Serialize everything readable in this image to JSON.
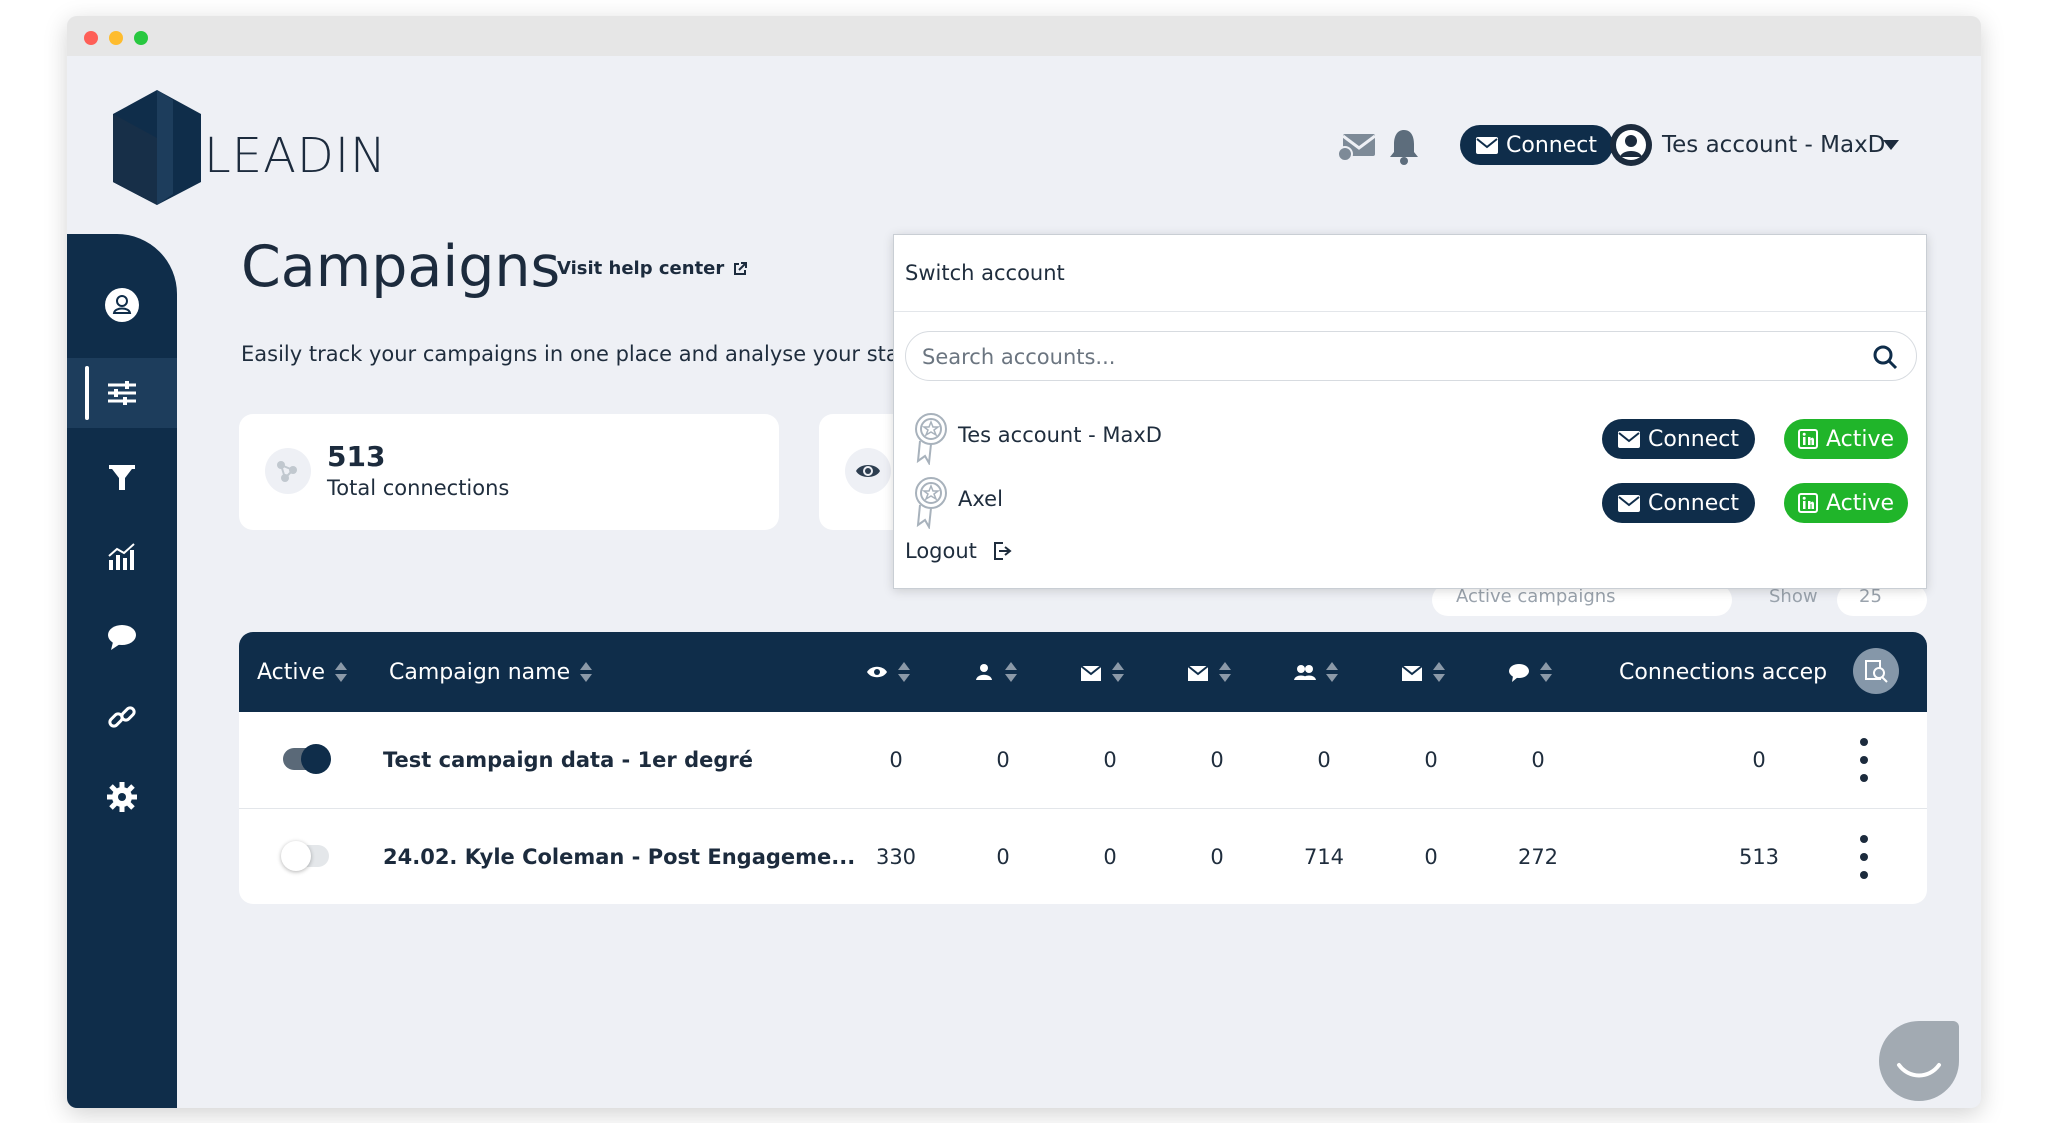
{
  "brand": {
    "name": "LEADIN"
  },
  "header": {
    "connect_label": "Connect",
    "account_name": "Tes account - MaxD"
  },
  "sidebar": {
    "items": [
      "profile",
      "campaigns",
      "filter",
      "stats",
      "messages",
      "links",
      "settings"
    ]
  },
  "page": {
    "title": "Campaigns",
    "help_link": "Visit help center",
    "subtitle": "Easily track your campaigns in one place and analyse your sta"
  },
  "stats": {
    "total_connections_value": "513",
    "total_connections_label": "Total connections"
  },
  "behind_dropdown": {
    "filter_label": "Active campaigns",
    "show_label": "Show",
    "show_value": "25"
  },
  "table": {
    "headers": {
      "active": "Active",
      "campaign_name": "Campaign name",
      "connections": "Connections accep"
    },
    "rows": [
      {
        "active": true,
        "name": "Test campaign data - 1er degré",
        "values": [
          "0",
          "0",
          "0",
          "0",
          "0",
          "0",
          "0"
        ],
        "connections": "0"
      },
      {
        "active": false,
        "name": "24.02. Kyle Coleman - Post Engageme...",
        "values": [
          "330",
          "0",
          "0",
          "0",
          "714",
          "0",
          "272"
        ],
        "connections": "513"
      }
    ]
  },
  "dropdown": {
    "title": "Switch account",
    "search_placeholder": "Search accounts...",
    "accounts": [
      {
        "name": "Tes account - MaxD",
        "connect_label": "Connect",
        "status_label": "Active"
      },
      {
        "name": "Axel",
        "connect_label": "Connect",
        "status_label": "Active"
      }
    ],
    "logout_label": "Logout"
  },
  "colors": {
    "navy": "#0f2d4a",
    "active_green": "#20b52a",
    "background": "#eef0f5"
  }
}
